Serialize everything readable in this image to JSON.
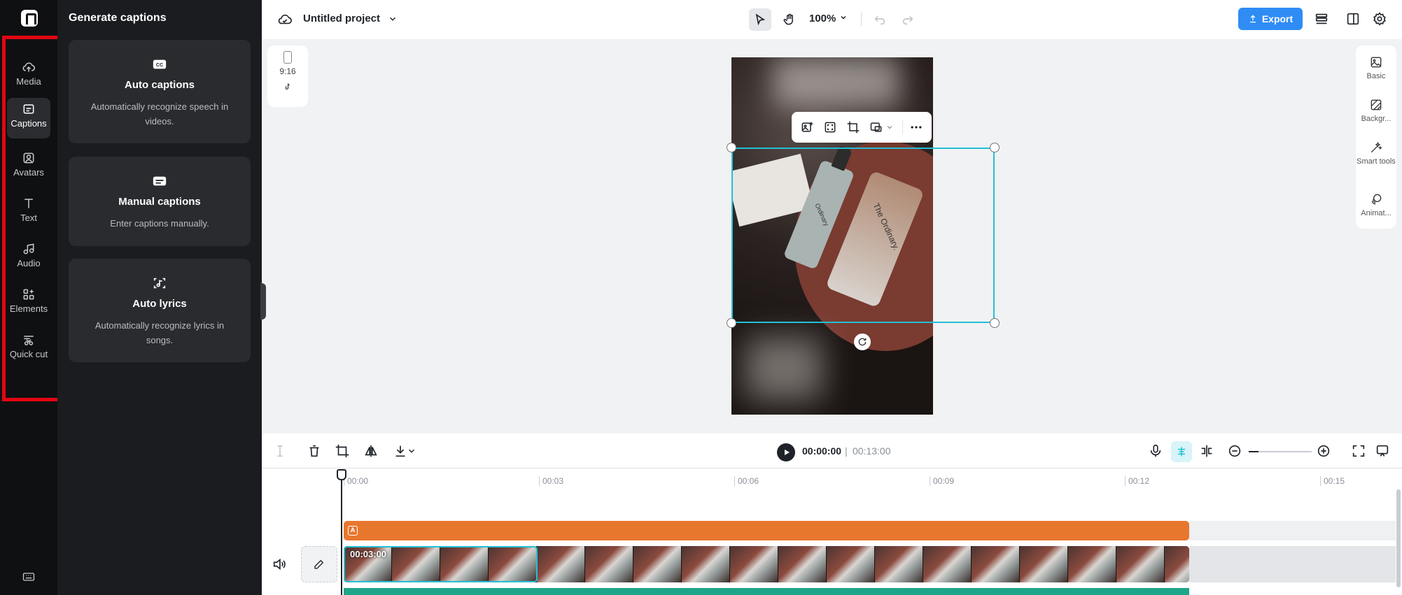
{
  "rail": {
    "items": [
      {
        "label": "Media",
        "icon": "cloud-upload-icon"
      },
      {
        "label": "Captions",
        "icon": "captions-icon"
      },
      {
        "label": "Avatars",
        "icon": "avatar-icon"
      },
      {
        "label": "Text",
        "icon": "text-icon"
      },
      {
        "label": "Audio",
        "icon": "music-icon"
      },
      {
        "label": "Elements",
        "icon": "elements-icon"
      },
      {
        "label": "Quick cut",
        "icon": "scissors-icon"
      }
    ],
    "active": "Captions"
  },
  "panel": {
    "title": "Generate captions",
    "cards": [
      {
        "title": "Auto captions",
        "description": "Automatically recognize speech in videos.",
        "icon": "cc-icon"
      },
      {
        "title": "Manual captions",
        "description": "Enter captions manually.",
        "icon": "subtitle-icon"
      },
      {
        "title": "Auto lyrics",
        "description": "Automatically recognize lyrics in songs.",
        "icon": "lyrics-icon"
      }
    ]
  },
  "topbar": {
    "project_name": "Untitled project",
    "zoom": "100%",
    "export_label": "Export"
  },
  "canvas": {
    "ratio": "9:16",
    "video_labels": [
      "Ordinary",
      "The Ordinary."
    ]
  },
  "right_panel": {
    "items": [
      "Basic",
      "Backgr...",
      "Smart tools",
      "Animat..."
    ]
  },
  "timeline": {
    "current_time": "00:00:00",
    "separator": "|",
    "total_time": "00:13:00",
    "ruler": [
      "00:00",
      "00:03",
      "00:06",
      "00:09",
      "00:12",
      "00:15"
    ],
    "clip_duration": "00:03:00"
  },
  "colors": {
    "accent": "#23c0d6",
    "export": "#2f8cf5",
    "caption_track": "#e8772e",
    "audio_track": "#1fa58a",
    "highlight": "#e30613"
  }
}
